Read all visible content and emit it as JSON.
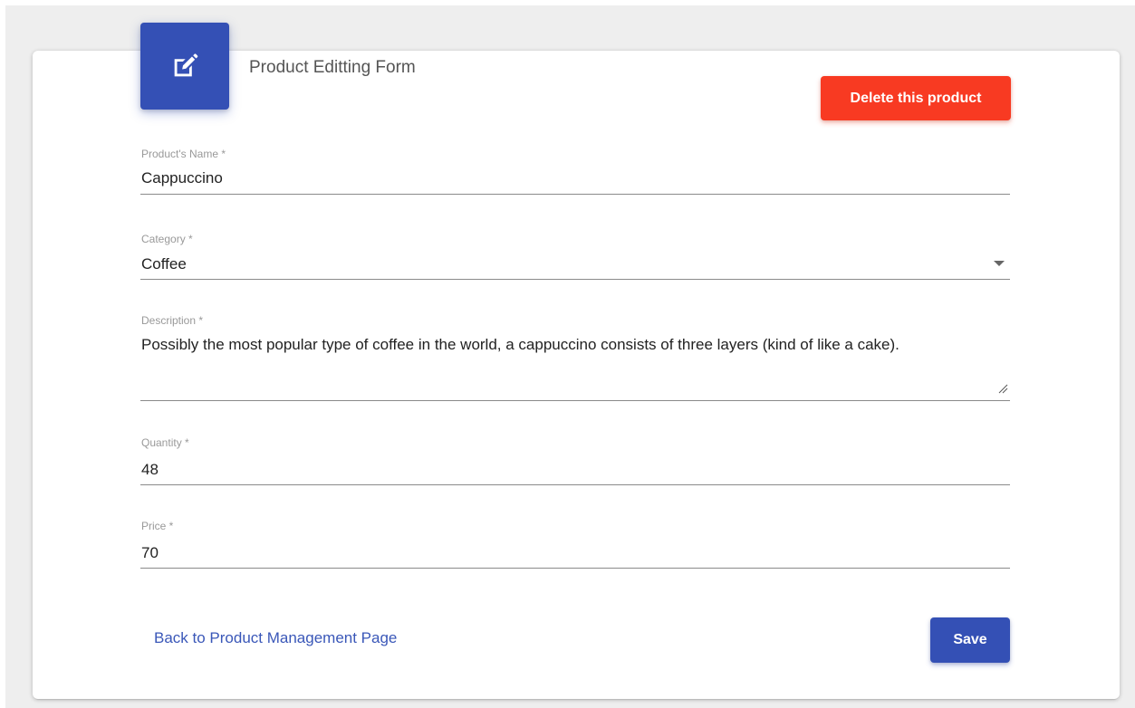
{
  "form": {
    "title": "Product Editting Form",
    "header_icon": "edit-icon",
    "delete_label": "Delete this product",
    "fields": {
      "name": {
        "label": "Product's Name *",
        "value": "Cappuccino"
      },
      "category": {
        "label": "Category *",
        "value": "Coffee"
      },
      "description": {
        "label": "Description *",
        "value": "Possibly the most popular type of coffee in the world, a cappuccino consists of three layers (kind of like a cake)."
      },
      "quantity": {
        "label": "Quantity *",
        "value": "48"
      },
      "price": {
        "label": "Price *",
        "value": "70"
      }
    },
    "back_link": "Back to Product Management Page",
    "save_label": "Save"
  },
  "colors": {
    "primary": "#3450b5",
    "danger": "#f83a22",
    "link": "#3a57b8"
  }
}
